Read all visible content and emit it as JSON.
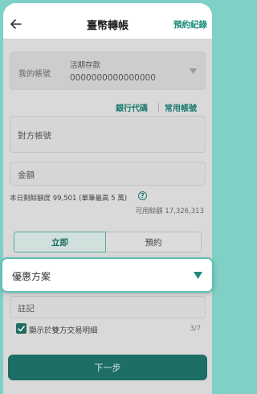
{
  "header": {
    "title": "臺幣轉帳",
    "schedule_link": "預約紀錄"
  },
  "my_account": {
    "label": "我的帳號",
    "type": "活期存款",
    "number": "0000000000000000"
  },
  "links": {
    "bank_code": "銀行代碼",
    "frequent_accounts": "常用帳號"
  },
  "payee_account": {
    "placeholder": "對方帳號"
  },
  "amount": {
    "placeholder": "金額"
  },
  "limits": {
    "remaining_today": "本日剩餘額度 99,501 (單筆最高 5 萬)",
    "available_balance": "可用餘額 17,326,313"
  },
  "timing": {
    "now_label": "立即",
    "scheduled_label": "預約",
    "selected": "立即"
  },
  "promo": {
    "label": "優惠方案"
  },
  "memo": {
    "placeholder": "註記",
    "counter": "3/7"
  },
  "show_detail": {
    "label": "顯示於雙方交易明細",
    "checked": true
  },
  "next_button": {
    "label": "下一步"
  },
  "colors": {
    "accent": "#1a8c7c",
    "button": "#1d6e64",
    "highlight_border": "#5fc0b3"
  }
}
